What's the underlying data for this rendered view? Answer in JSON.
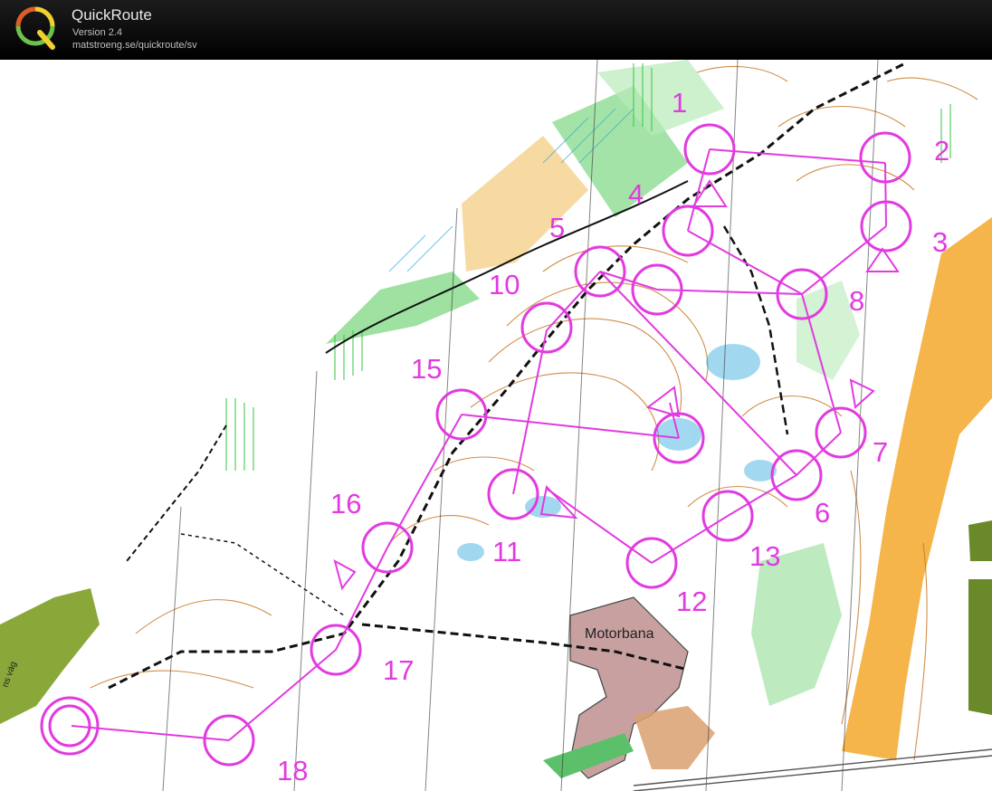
{
  "app": {
    "title": "QuickRoute",
    "version": "Version 2.4",
    "url": "matstroeng.se/quickroute/sv"
  },
  "map": {
    "course_color": "#e23ae0",
    "start_symbol": "triangle",
    "finish_symbol": "double-circle",
    "controls": [
      {
        "label": "1"
      },
      {
        "label": "2"
      },
      {
        "label": "3"
      },
      {
        "label": "4"
      },
      {
        "label": "5"
      },
      {
        "label": "6"
      },
      {
        "label": "7"
      },
      {
        "label": "8"
      },
      {
        "label": "10"
      },
      {
        "label": "11"
      },
      {
        "label": "12"
      },
      {
        "label": "13"
      },
      {
        "label": "15"
      },
      {
        "label": "16"
      },
      {
        "label": "17"
      },
      {
        "label": "18"
      }
    ],
    "features": {
      "motorbana": "Motorbana",
      "road_label": "ns väg"
    },
    "colors": {
      "open_land": "#f5b54a",
      "field_green": "#86d98a",
      "forest_white": "#ffffff",
      "contour_brown": "#c87a2a",
      "water_blue": "#33aadd",
      "settlement_olive": "#8aa83a",
      "paved_gray": "#c8a0a0"
    }
  }
}
